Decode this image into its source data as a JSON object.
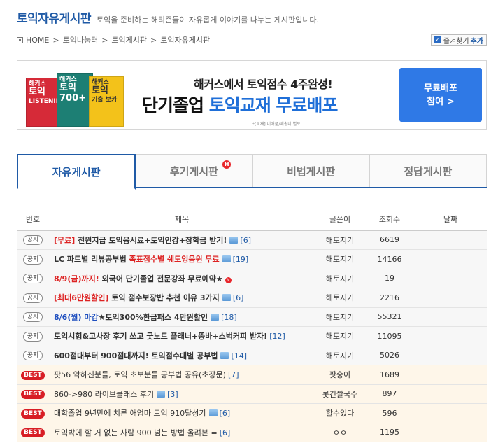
{
  "header": {
    "title": "토익자유게시판",
    "description": "토익을 준비하는 해티즌들이 자유롭게 이야기를 나누는 게시판입니다."
  },
  "breadcrumb": [
    "HOME",
    "토익나눔터",
    "토익게시판",
    "토익자유게시판"
  ],
  "favorite": {
    "label": "즐겨찾기",
    "add": "추가"
  },
  "banner": {
    "line1": "해커스에서 토익점수 4주완성!",
    "line2_a": "단기졸업 ",
    "line2_b": "토익교재 무료배포",
    "fine_print": "*[교재] 비매품/배송비 별도",
    "cta_line1": "무료배포",
    "cta_line2": "참여 >",
    "books": [
      {
        "brand": "해커스",
        "name": "토익",
        "sub": "LISTENING"
      },
      {
        "brand": "해커스",
        "name": "토익",
        "sub": "700+"
      },
      {
        "brand": "해커스",
        "name": "토익",
        "sub": "기출 보카"
      }
    ]
  },
  "tabs": [
    {
      "label": "자유게시판",
      "active": true
    },
    {
      "label": "후기게시판",
      "hot": "H"
    },
    {
      "label": "비법게시판"
    },
    {
      "label": "정답게시판"
    }
  ],
  "columns": [
    "번호",
    "제목",
    "글쓴이",
    "조회수",
    "날짜"
  ],
  "rows": [
    {
      "badge": "공지",
      "type": "notice",
      "prefix": "[무료]",
      "title": " 전원지급 토익응시료+토익인강+장학금 받기!",
      "img": true,
      "comments": "[6]",
      "author": "해토지기",
      "views": "6619",
      "date": ""
    },
    {
      "badge": "공지",
      "type": "notice",
      "title": "LC 파트별 리뷰공부법 ",
      "red": "족표점수별 쉐도잉음원 무료",
      "img": true,
      "comments": "[19]",
      "author": "해토지기",
      "views": "14166",
      "date": ""
    },
    {
      "badge": "공지",
      "type": "notice",
      "prefix": "8/9(금)까지!",
      "title": " 외국어 단기졸업 전문강좌 무료예약★",
      "new": "N",
      "author": "해토지기",
      "views": "19",
      "date": ""
    },
    {
      "badge": "공지",
      "type": "notice",
      "prefix": "[최대6만원할인]",
      "title": " 토익 점수보장반 추천 이유 3가지",
      "img": true,
      "comments": "[6]",
      "author": "해토지기",
      "views": "2216",
      "date": ""
    },
    {
      "badge": "공지",
      "type": "notice",
      "blue": "8/6(월) 마감",
      "title": "★토익300%환급패스 4만원할인",
      "img": true,
      "comments": "[18]",
      "author": "해토지기",
      "views": "55321",
      "date": ""
    },
    {
      "badge": "공지",
      "type": "notice",
      "title": "토익시험&고사장 후기 쓰고 굿노트 플래너+뚱바+스벅커피 받자!",
      "comments": "[12]",
      "author": "해토지기",
      "views": "11095",
      "date": ""
    },
    {
      "badge": "공지",
      "type": "notice",
      "title": "600점대부터 900점대까지! 토익점수대별 공부법",
      "img": true,
      "comments": "[14]",
      "author": "해토지기",
      "views": "5026",
      "date": ""
    },
    {
      "badge": "BEST",
      "type": "best",
      "title": "팟56 약하신분들, 토익 초보분들 공부법 공유(초장문)",
      "comments": "[7]",
      "author": "팟숭이",
      "views": "1689",
      "date": ""
    },
    {
      "badge": "BEST",
      "type": "best",
      "title": "860->980 라이브클래스 후기",
      "img": true,
      "comments": "[3]",
      "author": "롯긴쌀국수",
      "views": "897",
      "date": ""
    },
    {
      "badge": "BEST",
      "type": "best",
      "title": "대학졸업 9년만에 치른 애엄마 토익 910달성기",
      "img": true,
      "comments": "[6]",
      "author": "할수있다",
      "views": "596",
      "date": ""
    },
    {
      "badge": "BEST",
      "type": "best",
      "title": "토익밖에 할 거 없는 사람 900 넘는 방법 올려본 =",
      "comments": "[6]",
      "author": "ㅇㅇ",
      "views": "1195",
      "date": ""
    }
  ],
  "colors": {
    "brand": "#1f5aa6",
    "accent": "#2f79e6",
    "best": "#d81e25"
  }
}
